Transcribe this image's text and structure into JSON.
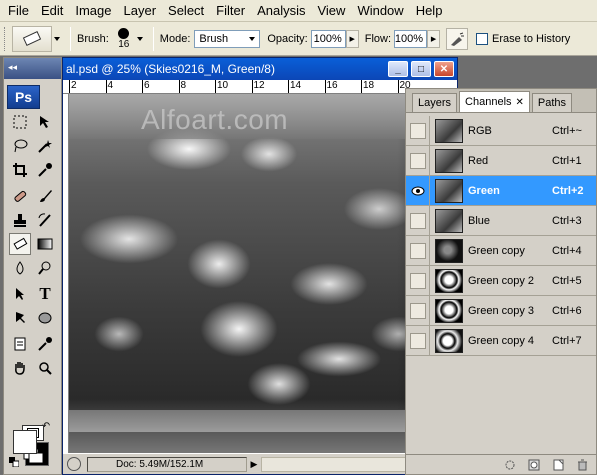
{
  "menu": [
    "File",
    "Edit",
    "Image",
    "Layer",
    "Select",
    "Filter",
    "Analysis",
    "View",
    "Window",
    "Help"
  ],
  "options": {
    "brush_label": "Brush:",
    "brush_size": "16",
    "mode_label": "Mode:",
    "mode_value": "Brush",
    "opacity_label": "Opacity:",
    "opacity_value": "100%",
    "flow_label": "Flow:",
    "flow_value": "100%",
    "erase_history_label": "Erase to History"
  },
  "toolbox": {
    "logo": "Ps"
  },
  "document": {
    "title": "al.psd @ 25% (Skies0216_M, Green/8)",
    "ruler_marks": [
      "2",
      "4",
      "6",
      "8",
      "10",
      "12",
      "14",
      "16",
      "18",
      "20"
    ],
    "watermark": "Alfoart.com",
    "status_doc": "Doc: 5.49M/152.1M"
  },
  "panel": {
    "tabs": [
      {
        "label": "Layers",
        "active": false
      },
      {
        "label": "Channels",
        "active": true
      },
      {
        "label": "Paths",
        "active": false
      }
    ],
    "channels": [
      {
        "name": "RGB",
        "shortcut": "Ctrl+~",
        "visible": false,
        "selected": false,
        "thumb": "gray"
      },
      {
        "name": "Red",
        "shortcut": "Ctrl+1",
        "visible": false,
        "selected": false,
        "thumb": "gray"
      },
      {
        "name": "Green",
        "shortcut": "Ctrl+2",
        "visible": true,
        "selected": true,
        "thumb": "gray"
      },
      {
        "name": "Blue",
        "shortcut": "Ctrl+3",
        "visible": false,
        "selected": false,
        "thumb": "gray"
      },
      {
        "name": "Green copy",
        "shortcut": "Ctrl+4",
        "visible": false,
        "selected": false,
        "thumb": "dark"
      },
      {
        "name": "Green copy 2",
        "shortcut": "Ctrl+5",
        "visible": false,
        "selected": false,
        "thumb": "bw"
      },
      {
        "name": "Green copy 3",
        "shortcut": "Ctrl+6",
        "visible": false,
        "selected": false,
        "thumb": "bw"
      },
      {
        "name": "Green copy 4",
        "shortcut": "Ctrl+7",
        "visible": false,
        "selected": false,
        "thumb": "bw2"
      }
    ]
  },
  "colors": {
    "selection": "#3399ff",
    "title_bar": "#0b46b6",
    "foreground": "#ffffff",
    "background": "#000000"
  }
}
